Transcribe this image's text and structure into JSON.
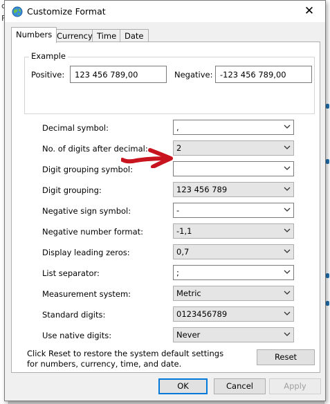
{
  "background": {
    "left_letters": [
      "c",
      "F"
    ],
    "right_marks": [
      1,
      2,
      3,
      4
    ]
  },
  "window": {
    "title": "Customize Format",
    "close_glyph": "✕"
  },
  "tabs": [
    {
      "label": "Numbers",
      "active": true
    },
    {
      "label": "Currency",
      "active": false
    },
    {
      "label": "Time",
      "active": false
    },
    {
      "label": "Date",
      "active": false
    }
  ],
  "example": {
    "group_title": "Example",
    "positive_label": "Positive:",
    "positive_value": "123 456 789,00",
    "negative_label": "Negative:",
    "negative_value": "-123 456 789,00"
  },
  "settings": [
    {
      "label": "Decimal symbol:",
      "value": ",",
      "editable": true
    },
    {
      "label": "No. of digits after decimal:",
      "value": "2",
      "editable": false
    },
    {
      "label": "Digit grouping symbol:",
      "value": "",
      "editable": true
    },
    {
      "label": "Digit grouping:",
      "value": "123 456 789",
      "editable": false
    },
    {
      "label": "Negative sign symbol:",
      "value": "-",
      "editable": true
    },
    {
      "label": "Negative number format:",
      "value": "-1,1",
      "editable": false
    },
    {
      "label": "Display leading zeros:",
      "value": "0,7",
      "editable": false
    },
    {
      "label": "List separator:",
      "value": ";",
      "editable": true
    },
    {
      "label": "Measurement system:",
      "value": "Metric",
      "editable": false
    },
    {
      "label": "Standard digits:",
      "value": "0123456789",
      "editable": false
    },
    {
      "label": "Use native digits:",
      "value": "Never",
      "editable": false
    }
  ],
  "reset_note": "Click Reset to restore the system default settings for numbers, currency, time, and date.",
  "buttons": {
    "reset": "Reset",
    "ok": "OK",
    "cancel": "Cancel",
    "apply": "Apply"
  },
  "colors": {
    "annotation_arrow": "#c8141e",
    "accent": "#0078d7"
  },
  "icons": {
    "title": "globe-icon",
    "close": "close-icon",
    "dropdown": "chevron-down-icon",
    "annotation": "red-arrow-annotation"
  }
}
